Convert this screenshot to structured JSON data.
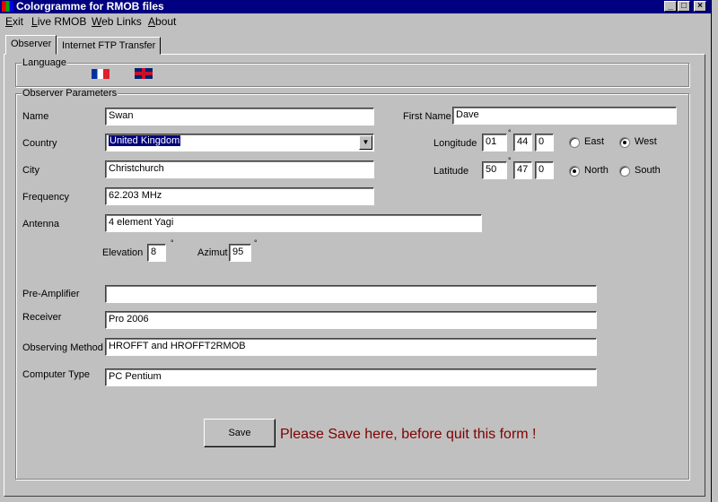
{
  "window": {
    "title": "Colorgramme for RMOB files",
    "controls": [
      "minimize",
      "maximize",
      "close"
    ]
  },
  "menu": [
    {
      "label": "Exit",
      "key": "E"
    },
    {
      "label": "Live RMOB",
      "key": "L"
    },
    {
      "label": "Web Links",
      "key": "W"
    },
    {
      "label": "About",
      "key": "A"
    }
  ],
  "tabs": [
    {
      "label": "Observer",
      "active": true
    },
    {
      "label": "Internet FTP Transfer",
      "active": false
    }
  ],
  "language": {
    "label": "Language",
    "flags": [
      "french-flag-icon",
      "uk-flag-icon"
    ]
  },
  "observer": {
    "group_label": "Observer Parameters",
    "name": {
      "label": "Name",
      "value": "Swan"
    },
    "first_name": {
      "label": "First Name",
      "value": "Dave"
    },
    "country": {
      "label": "Country",
      "value": "United Kingdom"
    },
    "city": {
      "label": "City",
      "value": "Christchurch"
    },
    "frequency": {
      "label": "Frequency",
      "value": "62.203 MHz"
    },
    "antenna": {
      "label": "Antenna",
      "value": "4 element Yagi"
    },
    "elevation": {
      "label": "Elevation",
      "value": "8",
      "unit": "°"
    },
    "azimut": {
      "label": "Azimut",
      "value": "95",
      "unit": "°"
    },
    "longitude": {
      "label": "Longitude",
      "deg": "01",
      "min": "44",
      "sec": "0",
      "unit": "°",
      "options": [
        "East",
        "West"
      ],
      "selected": "West"
    },
    "latitude": {
      "label": "Latitude",
      "deg": "50",
      "min": "47",
      "sec": "0",
      "unit": "°",
      "options": [
        "North",
        "South"
      ],
      "selected": "North"
    },
    "pre_amplifier": {
      "label": "Pre-Amplifier",
      "value": ""
    },
    "receiver": {
      "label": "Receiver",
      "value": "Pro 2006"
    },
    "observing_method": {
      "label": "Observing Method",
      "value": "HROFFT  and  HROFFT2RMOB"
    },
    "computer_type": {
      "label": "Computer Type",
      "value": "PC Pentium"
    }
  },
  "save": {
    "label": "Save",
    "message": "Please Save here, before quit this form !",
    "message_color": "#800000"
  }
}
